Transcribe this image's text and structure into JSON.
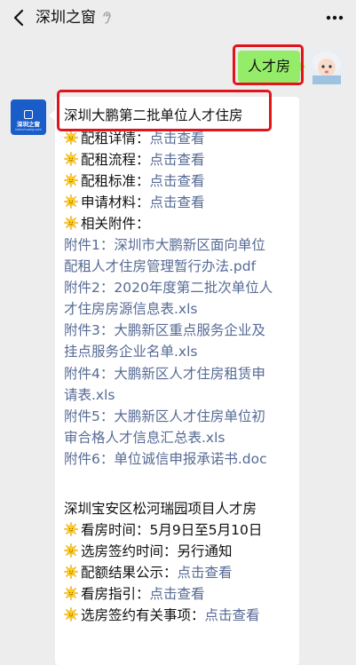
{
  "header": {
    "title": "深圳之窗"
  },
  "outgoing": {
    "text": "人才房"
  },
  "incoming": {
    "section1": {
      "title": "深圳大鹏第二批单位人才住房",
      "items": [
        {
          "label": "配租详情：",
          "link": "点击查看"
        },
        {
          "label": "配租流程：",
          "link": "点击查看"
        },
        {
          "label": "配租标准：",
          "link": "点击查看"
        },
        {
          "label": "申请材料：",
          "link": "点击查看"
        }
      ],
      "attachments_label": "相关附件：",
      "attachment_lines": [
        "附件1：深圳市大鹏新区面向单位",
        "配租人才住房管理暂行办法.pdf",
        "附件2：2020年度第二批次单位人",
        "才住房房源信息表.xls",
        "附件3：大鹏新区重点服务企业及",
        "挂点服务企业名单.xls",
        "附件4：大鹏新区人才住房租赁申",
        "请表.xls",
        "附件5：大鹏新区人才住房单位初",
        "审合格人才信息汇总表.xls",
        "附件6：单位诚信申报承诺书.doc"
      ]
    },
    "section2": {
      "title": "深圳宝安区松河瑞园项目人才房",
      "items": [
        {
          "label": "看房时间：",
          "value": "5月9日至5月10日"
        },
        {
          "label": "选房签约时间：",
          "value": "另行通知"
        },
        {
          "label": "配额结果公示：",
          "link": "点击查看"
        },
        {
          "label": "看房指引：",
          "link": "点击查看"
        },
        {
          "label": "选房签约有关事项：",
          "link": "点击查看"
        }
      ]
    },
    "avatar_logo": {
      "name": "深圳之窗",
      "domain": "shenchuang.com"
    }
  },
  "icons": {
    "back": "chevron-left-icon",
    "mute": "ear-icon",
    "more": "more-dots-icon",
    "emoji": "sun-emoji-icon"
  },
  "colors": {
    "bg": "#ededed",
    "link": "#576b95",
    "outgoing_bubble": "#95ec69",
    "highlight": "#e0151b",
    "logo": "#1a5cc8"
  }
}
